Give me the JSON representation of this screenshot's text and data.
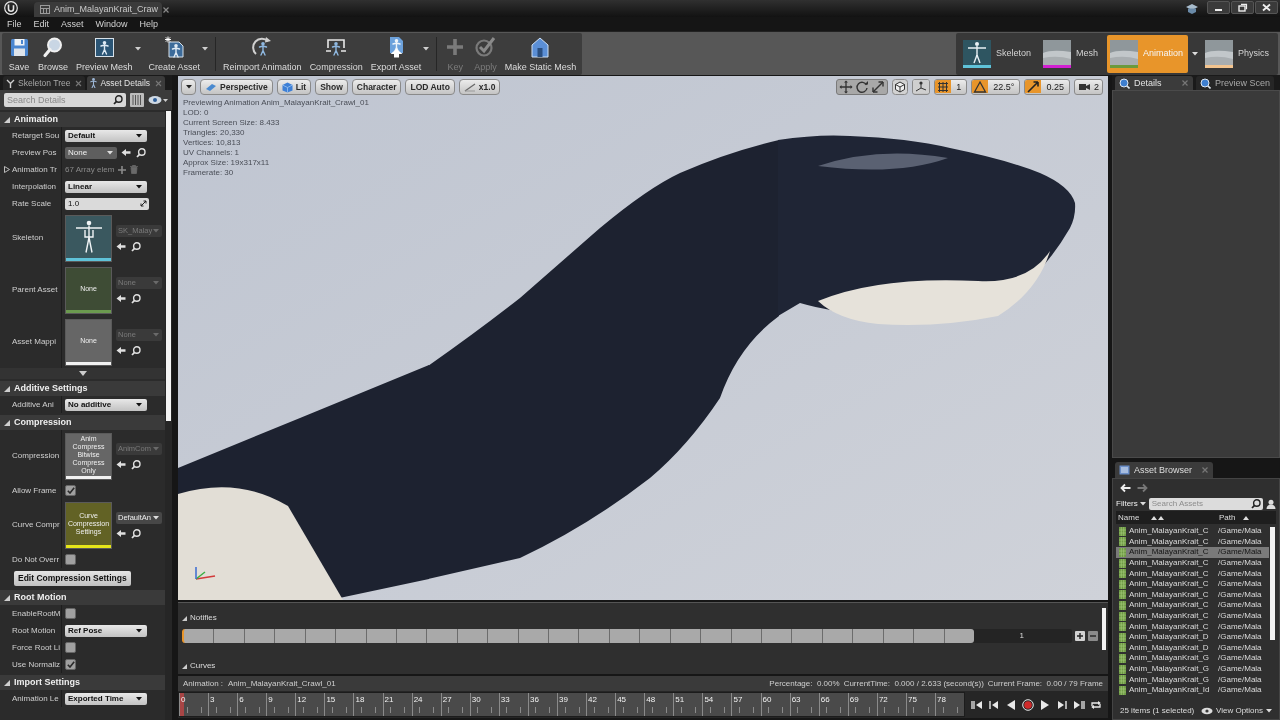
{
  "window": {
    "tab_title": "Anim_MalayanKrait_Craw"
  },
  "menu": [
    "File",
    "Edit",
    "Asset",
    "Window",
    "Help"
  ],
  "toolbar": {
    "groups": [
      [
        {
          "label": "Save",
          "kind": "save",
          "dropdown": false,
          "disabled": false
        },
        {
          "label": "Browse",
          "kind": "browse",
          "dropdown": false,
          "disabled": false
        },
        {
          "label": "Preview Mesh",
          "kind": "preview_mesh",
          "dropdown": true,
          "disabled": false
        },
        {
          "label": "Create Asset",
          "kind": "create_asset",
          "dropdown": true,
          "disabled": false
        }
      ],
      [
        {
          "label": "Reimport Animation",
          "kind": "reimport",
          "dropdown": false,
          "disabled": false
        },
        {
          "label": "Compression",
          "kind": "compression",
          "dropdown": false,
          "disabled": false
        },
        {
          "label": "Export Asset",
          "kind": "export",
          "dropdown": true,
          "disabled": false
        }
      ],
      [
        {
          "label": "Key",
          "kind": "key",
          "dropdown": false,
          "disabled": true
        },
        {
          "label": "Apply",
          "kind": "apply",
          "dropdown": false,
          "disabled": true
        },
        {
          "label": "Make Static Mesh",
          "kind": "static_mesh",
          "dropdown": false,
          "disabled": false
        }
      ]
    ]
  },
  "modes": [
    {
      "label": "Skeleton",
      "kind": "skeleton",
      "color": "#5fc3d9",
      "selected": false,
      "dropdown": false
    },
    {
      "label": "Mesh",
      "kind": "mesh",
      "color": "#d21fd2",
      "selected": false,
      "dropdown": false
    },
    {
      "label": "Animation",
      "kind": "animation",
      "color": "#6c9a3c",
      "selected": true,
      "dropdown": true
    },
    {
      "label": "Physics",
      "kind": "physics",
      "color": "#f3c48f",
      "selected": false,
      "dropdown": false
    }
  ],
  "left_panel": {
    "tabs": [
      {
        "label": "Skeleton Tree",
        "kind": "skeleton_tree",
        "selected": false
      },
      {
        "label": "Asset Details",
        "kind": "asset_details",
        "selected": true
      }
    ],
    "search": {
      "placeholder": "Search Details"
    },
    "sections": [
      {
        "title": "Animation",
        "expanded": true,
        "advanced": {
          "expanded": false
        },
        "rows": [
          {
            "kind": "combo",
            "label": "Retarget Sou",
            "value": "Default"
          },
          {
            "kind": "picker",
            "label": "Preview Pos",
            "value": "None"
          },
          {
            "kind": "array",
            "label": "Animation Tr",
            "value": "67 Array elem",
            "expanded": false
          },
          {
            "kind": "combo",
            "label": "Interpolation",
            "value": "Linear"
          },
          {
            "kind": "number",
            "label": "Rate Scale",
            "value": "1.0"
          },
          {
            "kind": "asset",
            "label": "Skeleton",
            "color": "#5fc3d9",
            "value": "SK_Malay",
            "disabled": true
          },
          {
            "kind": "asset",
            "label": "Parent Asset",
            "thumb_text": "None",
            "color": "#6b9a4f",
            "value": "None",
            "disabled": true
          },
          {
            "kind": "asset",
            "label": "Asset Mappi",
            "thumb_text": "None",
            "color": "#f2f2f2",
            "value": "None",
            "disabled": true
          }
        ]
      },
      {
        "title": "Additive Settings",
        "expanded": true,
        "rows": [
          {
            "kind": "combo",
            "label": "Additive Ani",
            "value": "No additive"
          }
        ]
      },
      {
        "title": "Compression",
        "expanded": true,
        "rows": [
          {
            "kind": "asset",
            "label": "Compression",
            "thumb_text": "Anim Compress Bitwise Compress Only",
            "color": "#f2f2f2",
            "value": "AnimCom",
            "disabled": true
          },
          {
            "kind": "checkbox",
            "label": "Allow Frame",
            "checked": true
          },
          {
            "kind": "asset",
            "label": "Curve Compr",
            "thumb_text": "Curve Compression Settings",
            "color": "#e6e619",
            "value": "DefaultAn",
            "disabled": false
          },
          {
            "kind": "checkbox",
            "label": "Do Not Overr",
            "checked": false
          },
          {
            "kind": "button",
            "label": "Edit Compression Settings"
          }
        ]
      },
      {
        "title": "Root Motion",
        "expanded": true,
        "rows": [
          {
            "kind": "checkbox",
            "label": "EnableRootM",
            "checked": false
          },
          {
            "kind": "combo",
            "label": "Root Motion",
            "value": "Ref Pose"
          },
          {
            "kind": "checkbox",
            "label": "Force Root Li",
            "checked": false
          },
          {
            "kind": "checkbox",
            "label": "Use Normaliz",
            "checked": true
          }
        ]
      },
      {
        "title": "Import Settings",
        "expanded": true,
        "rows": [
          {
            "kind": "combo",
            "label": "Animation Le",
            "value": "Exported Time"
          }
        ]
      }
    ]
  },
  "viewport": {
    "toolbar_left": [
      {
        "kind": "menu"
      },
      {
        "kind": "perspective",
        "label": "Perspective"
      },
      {
        "kind": "lit",
        "label": "Lit"
      },
      {
        "kind": "plain",
        "label": "Show"
      },
      {
        "kind": "plain",
        "label": "Character"
      },
      {
        "kind": "plain",
        "label": "LOD Auto"
      },
      {
        "kind": "speed",
        "label": "x1.0"
      }
    ],
    "snaps": [
      {
        "kind": "surface",
        "on": false
      },
      {
        "kind": "grid",
        "on": true,
        "value": "1"
      },
      {
        "kind": "rotation",
        "on": true,
        "value": "22.5°"
      },
      {
        "kind": "scale",
        "on": true,
        "value": "0.25"
      }
    ],
    "camera_speed": "2",
    "stats": [
      "Previewing Animation Anim_MalayanKrait_Crawl_01",
      "LOD: 0",
      "Current Screen Size: 8.433",
      "Triangles: 20,330",
      "Vertices: 10,813",
      "UV Channels: 1",
      "Approx Size: 19x317x11",
      "Framerate: 30"
    ]
  },
  "anim_timeline": {
    "sections": [
      {
        "kind": "notifies",
        "title": "Notifies",
        "expanded": true,
        "track_number": "1"
      },
      {
        "kind": "curves",
        "title": "Curves",
        "expanded": true
      }
    ],
    "info": {
      "label": "Animation :",
      "name": "Anim_MalayanKrait_Crawl_01",
      "stats": [
        "Percentage:  0.00%",
        "CurrentTime:  0.000 / 2.633 (second(s))",
        "Current Frame:  0.00 / 79 Frame"
      ]
    },
    "scrubber": {
      "level": 0,
      "frames": [
        "0",
        "3",
        "6",
        "9",
        "12",
        "15",
        "18",
        "21",
        "24",
        "27",
        "30",
        "33",
        "36",
        "39",
        "42",
        "45",
        "48",
        "51",
        "54",
        "57",
        "60",
        "63",
        "66",
        "69",
        "72",
        "75",
        "78"
      ]
    }
  },
  "right_panel": {
    "tabs": [
      {
        "label": "Details",
        "selected": true
      },
      {
        "label": "Preview Scen",
        "selected": false
      }
    ]
  },
  "asset_browser": {
    "tab": "Asset Browser",
    "filters": "Filters",
    "search": {
      "placeholder": "Search Assets"
    },
    "columns": [
      "Name",
      "Path"
    ],
    "rows": [
      {
        "name": "Anim_MalayanKrait_C",
        "path": "/Game/Mala",
        "selected": false
      },
      {
        "name": "Anim_MalayanKrait_C",
        "path": "/Game/Mala",
        "selected": false
      },
      {
        "name": "Anim_MalayanKrait_C",
        "path": "/Game/Mala",
        "selected": true
      },
      {
        "name": "Anim_MalayanKrait_C",
        "path": "/Game/Mala",
        "selected": false
      },
      {
        "name": "Anim_MalayanKrait_C",
        "path": "/Game/Mala",
        "selected": false
      },
      {
        "name": "Anim_MalayanKrait_C",
        "path": "/Game/Mala",
        "selected": false
      },
      {
        "name": "Anim_MalayanKrait_C",
        "path": "/Game/Mala",
        "selected": false
      },
      {
        "name": "Anim_MalayanKrait_C",
        "path": "/Game/Mala",
        "selected": false
      },
      {
        "name": "Anim_MalayanKrait_C",
        "path": "/Game/Mala",
        "selected": false
      },
      {
        "name": "Anim_MalayanKrait_C",
        "path": "/Game/Mala",
        "selected": false
      },
      {
        "name": "Anim_MalayanKrait_D",
        "path": "/Game/Mala",
        "selected": false
      },
      {
        "name": "Anim_MalayanKrait_D",
        "path": "/Game/Mala",
        "selected": false
      },
      {
        "name": "Anim_MalayanKrait_G",
        "path": "/Game/Mala",
        "selected": false
      },
      {
        "name": "Anim_MalayanKrait_G",
        "path": "/Game/Mala",
        "selected": false
      },
      {
        "name": "Anim_MalayanKrait_G",
        "path": "/Game/Mala",
        "selected": false
      },
      {
        "name": "Anim_MalayanKrait_Id",
        "path": "/Game/Mala",
        "selected": false
      }
    ],
    "footer": "25 items (1 selected)",
    "view_options": "View Options"
  }
}
